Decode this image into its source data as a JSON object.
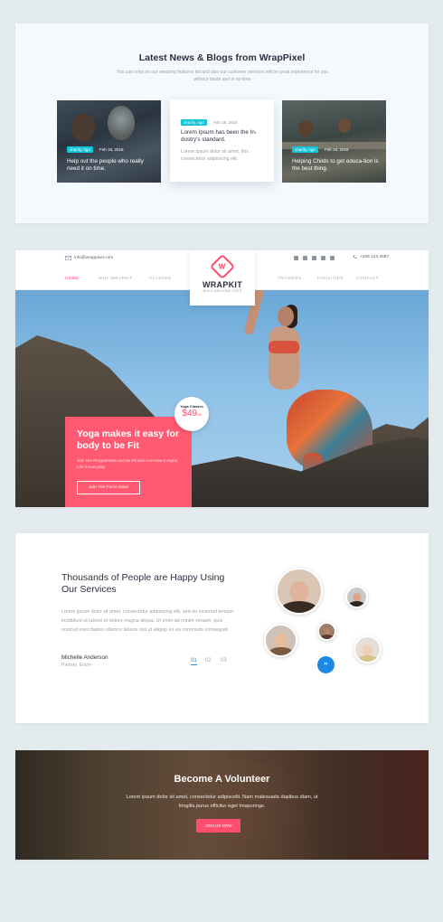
{
  "blog": {
    "title": "Latest News & Blogs from WrapPixel",
    "subtitle": "You can relay on our amazing features list and also our customer services will be great experience for you without doubt and in no-time",
    "cards": [
      {
        "tag": "charity, ngo",
        "date": "Feb 18, 2018",
        "headline": "Help out the people who really need it on time."
      },
      {
        "tag": "charity, ngo",
        "date": "Feb 18, 2018",
        "headline": "Lorem Ipsum has been the In-dustry's standard.",
        "excerpt": "Lorem ipsum dolor sit amet, this consectetur adipisicing elit."
      },
      {
        "tag": "charity, ngo",
        "date": "Feb 18, 2018",
        "headline": "Helping Childs to get educa-tion is the best thing."
      }
    ]
  },
  "header": {
    "email": "info@wrappixel.com",
    "phone": "+205 123 4567",
    "nav": [
      "HOME",
      "WHY WRAPKIT",
      "CLASSES",
      "TRAINERS",
      "FACILITIES",
      "CONTACT"
    ],
    "logo_name": "WRAPKIT",
    "logo_tagline": "BUILD AWESOME SITES",
    "logo_mark": "W"
  },
  "hero": {
    "badge_title": "Yoga Classes",
    "badge_price": "$49",
    "badge_unit": "/M",
    "headline": "Yoga makes it easy for body to be Fit",
    "description": "Join Our Programmes and Be Fit and Live How A Joyful Life is everyday.",
    "cta": "Join The Force Now!"
  },
  "testimonial": {
    "heading": "Thousands of People are Happy Using Our Services",
    "body": "Lorem ipsum dolor sit amet, consectetur adipisicing elit. sed do eiusmod tempor incididunt ut labore et dolore magna aliqua. Ut enim ad minim veniam, quis nostrud exercitation ullamco laboris nisi ut aliquip ex ea commodo consequat.",
    "name": "Michelle Anderson",
    "role": "Partner, Envin",
    "pages": [
      "01",
      "02",
      "03"
    ],
    "quote_icon": "“"
  },
  "volunteer": {
    "heading": "Become A Volunteer",
    "body": "Lorem ipsum dolor sit amet, consectetur adipiscelit. Nam malesuada dapibus diam, ut fringilla purus efficitur eget Imspurings.",
    "cta": "JOIN US NOW"
  },
  "colors": {
    "accent": "#ff4d6d",
    "tag": "#14c4d8",
    "blue": "#1e88e5"
  }
}
